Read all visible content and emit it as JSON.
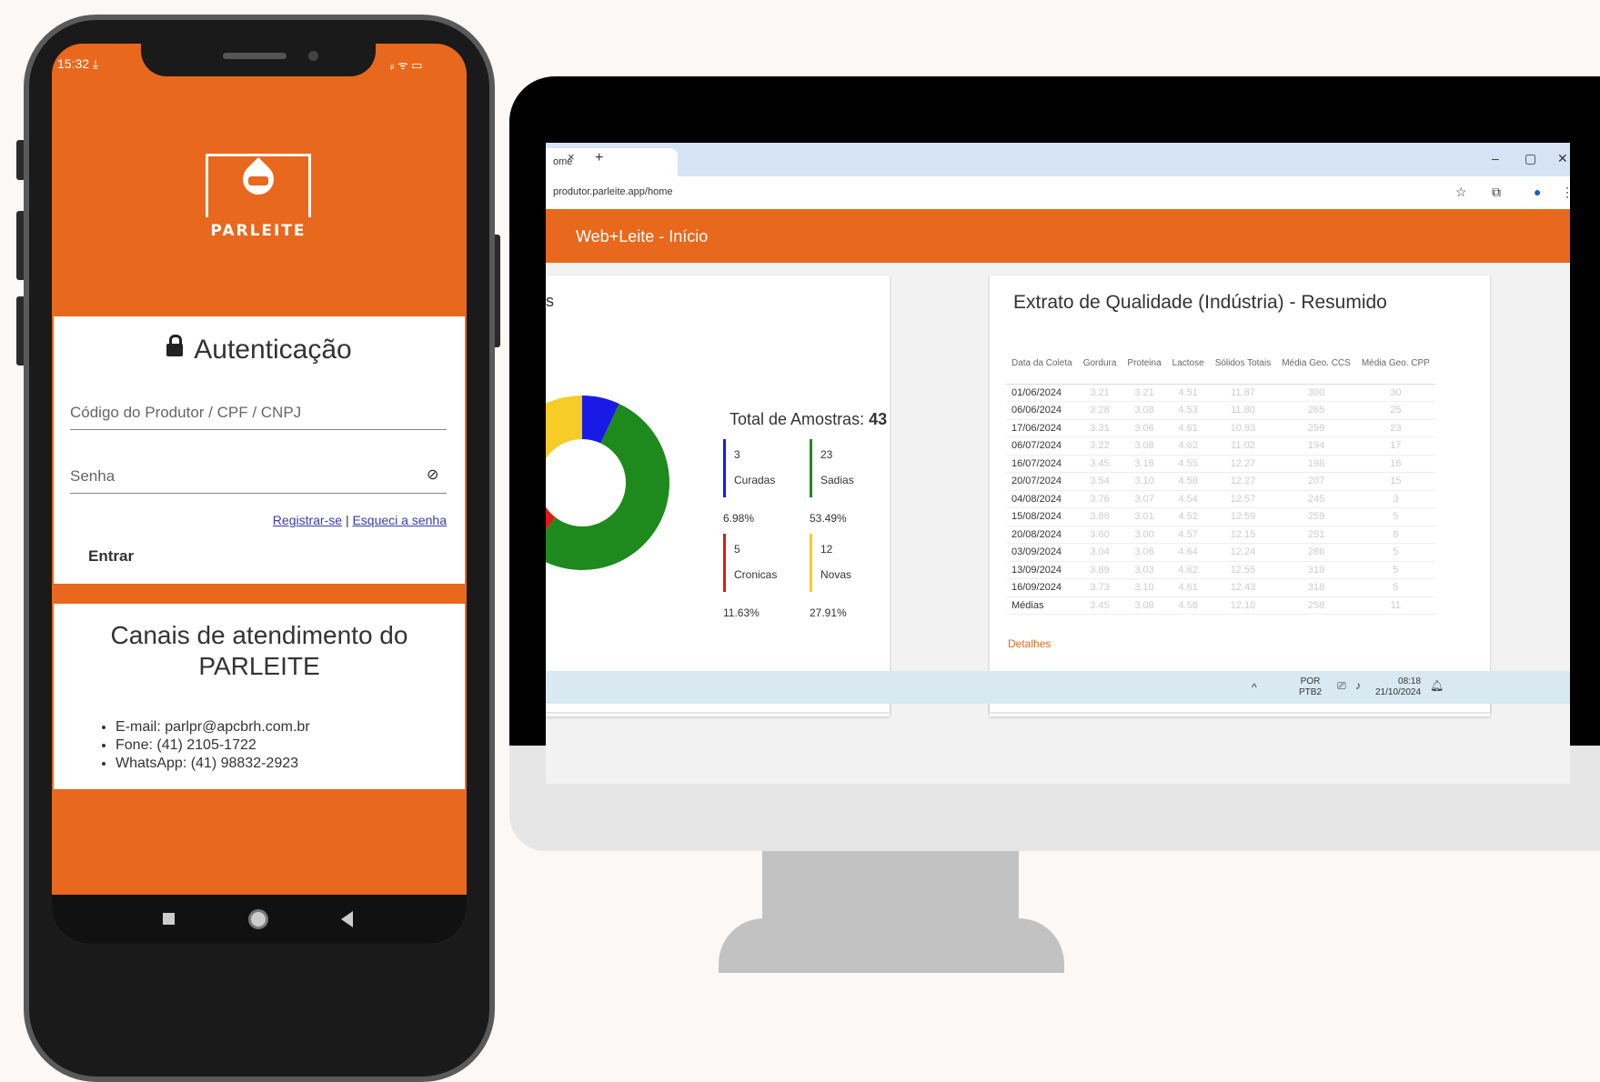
{
  "colors": {
    "brand_orange": "#e8681d",
    "green": "#1e8a1e",
    "blue": "#1a1ae6",
    "red": "#e01a1a",
    "yellow": "#f5cc28"
  },
  "phone": {
    "status_time": "15:32 ⤓",
    "status_right": "ᵢₗ ᯤ ▭",
    "logo_text": "PARLEITE",
    "auth": {
      "title": "Autenticação",
      "code_placeholder": "Código do Produtor / CPF / CNPJ",
      "password_placeholder": "Senha",
      "register_link": "Registrar-se",
      "separator": "|",
      "forgot_link": "Esqueci a senha",
      "submit": "Entrar"
    },
    "canais": {
      "title": "Canais de atendimento do PARLEITE",
      "items": [
        "E-mail: parlpr@apcbrh.com.br",
        "Fone: (41) 2105-1722",
        "WhatsApp: (41) 98832-2923"
      ]
    }
  },
  "browser": {
    "tab_label": "ome",
    "tab_close": "×",
    "new_tab": "+",
    "url": "produtor.parleite.app/home",
    "app_title": "Web+Leite - Início",
    "window": {
      "minimize": "–",
      "restore": "▢",
      "close": "✕"
    }
  },
  "left_card": {
    "title_fragment": "s",
    "total_label": "Total de Amostras:",
    "total_value": "43",
    "legend": [
      {
        "count": "3",
        "label": "Curadas",
        "pct": "6.98%",
        "color": "#1a1ae6"
      },
      {
        "count": "23",
        "label": "Sadias",
        "pct": "53.49%",
        "color": "#1e8a1e"
      },
      {
        "count": "5",
        "label": "Cronicas",
        "pct": "11.63%",
        "color": "#e01a1a"
      },
      {
        "count": "12",
        "label": "Novas",
        "pct": "27.91%",
        "color": "#f5cc28"
      }
    ]
  },
  "chart_data": {
    "type": "pie",
    "categories": [
      "Curadas",
      "Sadias",
      "Cronicas",
      "Novas"
    ],
    "values": [
      3,
      23,
      5,
      12
    ]
  },
  "right_card": {
    "title": "Extrato de Qualidade (Indústria) - Resumido",
    "headers": [
      "Data da Coleta",
      "Gordura",
      "Proteina",
      "Lactose",
      "Sólidos Totais",
      "Média Geo. CCS",
      "Média Geo. CPP"
    ],
    "rows": [
      [
        "01/06/2024",
        "3.21",
        "3.21",
        "4.51",
        "11.87",
        "300",
        "30"
      ],
      [
        "06/06/2024",
        "3.28",
        "3.08",
        "4.53",
        "11.80",
        "285",
        "25"
      ],
      [
        "17/06/2024",
        "3.31",
        "3.06",
        "4.61",
        "10.93",
        "259",
        "23"
      ],
      [
        "06/07/2024",
        "3.22",
        "3.08",
        "4.62",
        "11.02",
        "194",
        "17"
      ],
      [
        "16/07/2024",
        "3.45",
        "3.16",
        "4.55",
        "12.27",
        "198",
        "16"
      ],
      [
        "20/07/2024",
        "3.54",
        "3.10",
        "4.58",
        "12.27",
        "207",
        "15"
      ],
      [
        "04/08/2024",
        "3.76",
        "3.07",
        "4.54",
        "12.57",
        "245",
        "3"
      ],
      [
        "15/08/2024",
        "3.86",
        "3.01",
        "4.52",
        "12.59",
        "259",
        "5"
      ],
      [
        "20/08/2024",
        "3.60",
        "3.00",
        "4.57",
        "12.15",
        "251",
        "8"
      ],
      [
        "03/09/2024",
        "3.04",
        "3.06",
        "4.64",
        "12.24",
        "286",
        "5"
      ],
      [
        "13/09/2024",
        "3.89",
        "3.03",
        "4.62",
        "12.55",
        "319",
        "5"
      ],
      [
        "16/09/2024",
        "3.73",
        "3.10",
        "4.61",
        "12.43",
        "318",
        "5"
      ],
      [
        "Médias",
        "3.45",
        "3.08",
        "4.58",
        "12.10",
        "258",
        "11"
      ]
    ],
    "details_link": "Detalhes"
  },
  "taskbar": {
    "chevron": "^",
    "lang_top": "POR",
    "lang_bottom": "PTB2",
    "time": "08:18",
    "date": "21/10/2024"
  }
}
